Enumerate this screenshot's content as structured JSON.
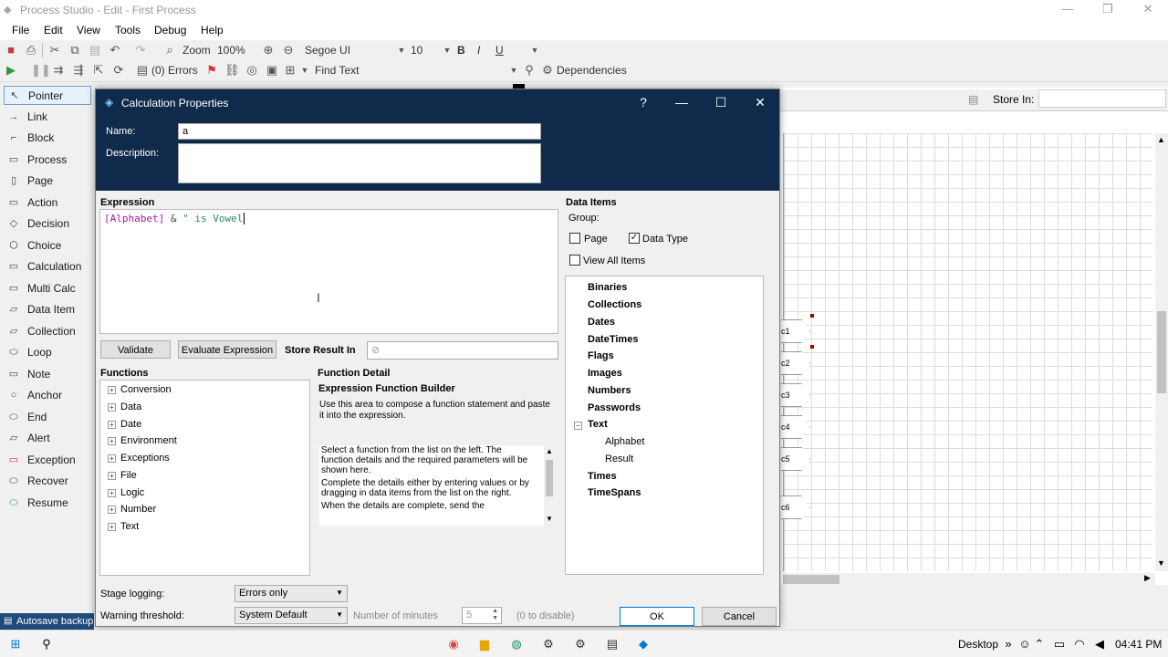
{
  "window": {
    "title": "Process Studio - Edit - First Process"
  },
  "menu": [
    "File",
    "Edit",
    "View",
    "Tools",
    "Debug",
    "Help"
  ],
  "toolbar1": {
    "zoom_label": "Zoom",
    "zoom_value": "100%",
    "font_name": "Segoe UI",
    "font_size": "10",
    "bold": "B",
    "italic": "I",
    "underline": "U"
  },
  "toolbar2": {
    "errors": "(0) Errors",
    "find_text": "Find Text",
    "dependencies": "Dependencies"
  },
  "palette": [
    "Pointer",
    "Link",
    "Block",
    "Process",
    "Page",
    "Action",
    "Decision",
    "Choice",
    "Calculation",
    "Multi Calc",
    "Data Item",
    "Collection",
    "Loop",
    "Note",
    "Anchor",
    "End",
    "Alert",
    "Exception",
    "Recover",
    "Resume"
  ],
  "background": {
    "store_in_label": "Store In:",
    "stages": [
      "c1",
      "c2",
      "c3",
      "c4",
      "c5",
      "c6"
    ]
  },
  "dialog": {
    "title": "Calculation Properties",
    "name_label": "Name:",
    "name_value": "a",
    "description_label": "Description:",
    "description_value": "",
    "expression_label": "Expression",
    "expression": {
      "part1": "[Alphabet]",
      "part2": " & ",
      "part3": "\" is Vowel"
    },
    "validate_button": "Validate",
    "evaluate_button": "Evaluate Expression",
    "store_result_label": "Store Result In",
    "store_result_value": "",
    "functions_label": "Functions",
    "functions": [
      "Conversion",
      "Data",
      "Date",
      "Environment",
      "Exceptions",
      "File",
      "Logic",
      "Number",
      "Text"
    ],
    "function_detail_label": "Function Detail",
    "function_builder_title": "Expression Function Builder",
    "function_builder_desc": "Use this area to compose a function statement and paste it into the expression.",
    "help_p1": "Select a function from the list on the left. The function details and the required parameters will be shown here.",
    "help_p2": "Complete the details either by entering values or by dragging in data items from the list on the right.",
    "help_p3": "When the details are complete, send the",
    "data_items_label": "Data Items",
    "group_label": "Group:",
    "page_checkbox": "Page",
    "datatype_checkbox": "Data Type",
    "view_all_checkbox": "View All Items",
    "data_tree": [
      "Binaries",
      "Collections",
      "Dates",
      "DateTimes",
      "Flags",
      "Images",
      "Numbers",
      "Passwords",
      "Text",
      "Times",
      "TimeSpans"
    ],
    "text_children": [
      "Alphabet",
      "Result"
    ],
    "stage_logging_label": "Stage logging:",
    "stage_logging_value": "Errors only",
    "warning_threshold_label": "Warning threshold:",
    "warning_threshold_value": "System Default",
    "minutes_label": "Number of minutes",
    "minutes_value": "5",
    "disable_hint": "(0 to disable)",
    "ok_button": "OK",
    "cancel_button": "Cancel"
  },
  "statusbar": {
    "text": "Autosave backup"
  },
  "taskbar": {
    "desktop": "Desktop",
    "time": "04:41 PM"
  },
  "colors": {
    "dialog_header": "#0f2a4a",
    "expression_field": "#a020a0",
    "expression_string": "#2e8b57"
  }
}
